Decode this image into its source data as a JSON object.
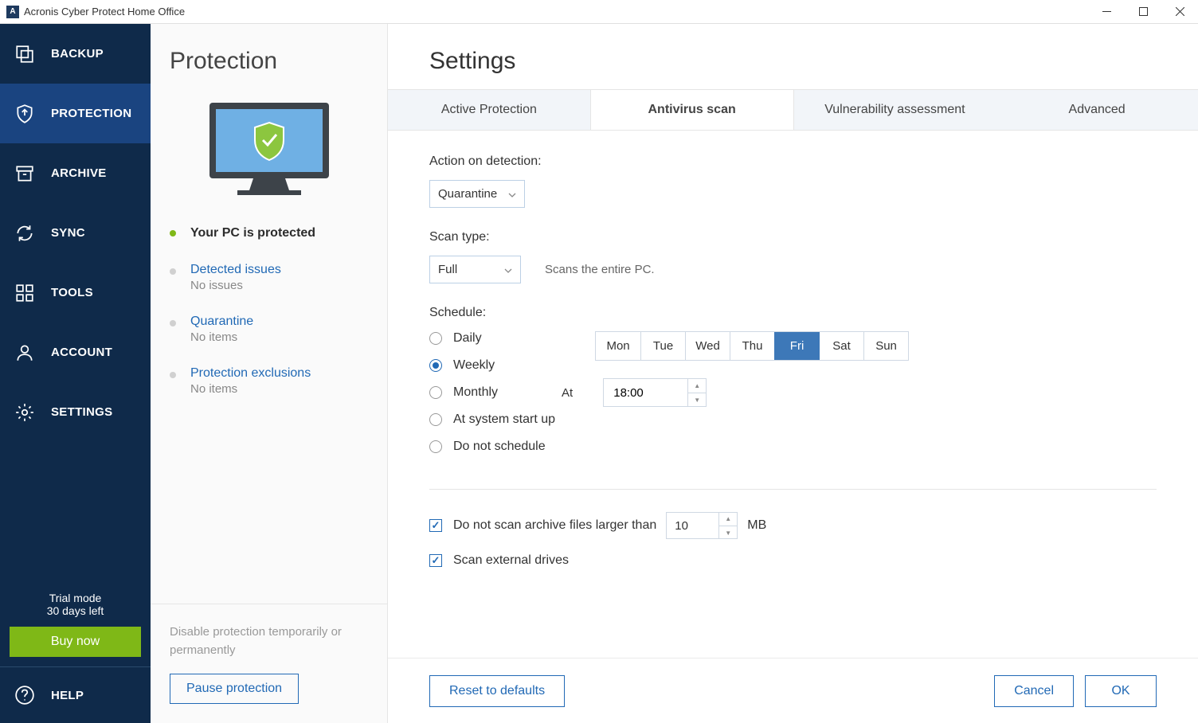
{
  "titlebar": {
    "title": "Acronis Cyber Protect Home Office"
  },
  "sidebar": {
    "items": [
      {
        "label": "BACKUP"
      },
      {
        "label": "PROTECTION"
      },
      {
        "label": "ARCHIVE"
      },
      {
        "label": "SYNC"
      },
      {
        "label": "TOOLS"
      },
      {
        "label": "ACCOUNT"
      },
      {
        "label": "SETTINGS"
      }
    ],
    "trial_line1": "Trial mode",
    "trial_line2": "30 days left",
    "buy_now": "Buy now",
    "help": "HELP"
  },
  "panel": {
    "title": "Protection",
    "status": "Your PC is protected",
    "links": [
      {
        "title": "Detected issues",
        "sub": "No issues"
      },
      {
        "title": "Quarantine",
        "sub": "No items"
      },
      {
        "title": "Protection exclusions",
        "sub": "No items"
      }
    ],
    "disable_text": "Disable protection temporarily or permanently",
    "pause": "Pause protection"
  },
  "main": {
    "title": "Settings",
    "tabs": [
      {
        "label": "Active Protection"
      },
      {
        "label": "Antivirus scan"
      },
      {
        "label": "Vulnerability assessment"
      },
      {
        "label": "Advanced"
      }
    ],
    "action_label": "Action on detection:",
    "action_value": "Quarantine",
    "scan_type_label": "Scan type:",
    "scan_type_value": "Full",
    "scan_type_hint": "Scans the entire PC.",
    "schedule_label": "Schedule:",
    "schedule_options": [
      "Daily",
      "Weekly",
      "Monthly",
      "At system start up",
      "Do not schedule"
    ],
    "days": [
      "Mon",
      "Tue",
      "Wed",
      "Thu",
      "Fri",
      "Sat",
      "Sun"
    ],
    "selected_day_index": 4,
    "at_label": "At",
    "at_value": "18:00",
    "max_archive_label": "Do not scan archive files larger than",
    "max_archive_value": "10",
    "max_archive_unit": "MB",
    "scan_external_label": "Scan external drives",
    "footer": {
      "reset": "Reset to defaults",
      "cancel": "Cancel",
      "ok": "OK"
    }
  }
}
